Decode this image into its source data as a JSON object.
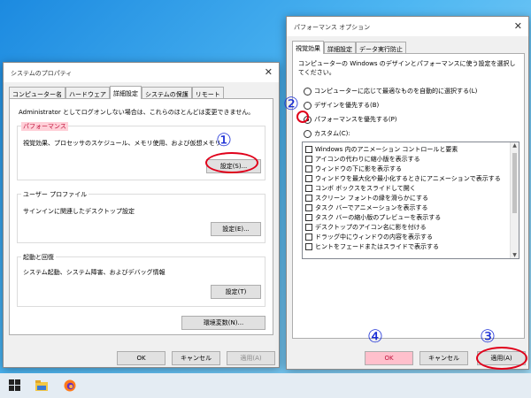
{
  "sysprops": {
    "title": "システムのプロパティ",
    "tabs": [
      "コンピューター名",
      "ハードウェア",
      "詳細設定",
      "システムの保護",
      "リモート"
    ],
    "admin_note": "Administrator としてログオンしない場合は、これらのほとんどは変更できません。",
    "perf_group": "パフォーマンス",
    "perf_desc": "視覚効果、プロセッサのスケジュール、メモリ使用、および仮想メモリ",
    "perf_button": "設定(S)...",
    "profile_group": "ユーザー プロファイル",
    "profile_desc": "サインインに関連したデスクトップ設定",
    "profile_button": "設定(E)...",
    "startup_group": "起動と回復",
    "startup_desc": "システム起動、システム障害、およびデバッグ情報",
    "startup_button": "設定(T)",
    "env_button": "環境変数(N)...",
    "ok": "OK",
    "cancel": "キャンセル",
    "apply": "適用(A)"
  },
  "perfopts": {
    "title": "パフォーマンス オプション",
    "tabs": [
      "視覚効果",
      "詳細設定",
      "データ実行防止"
    ],
    "desc": "コンピューターの Windows のデザインとパフォーマンスに使う設定を選択してください。",
    "radios": [
      {
        "label": "コンピューターに応じて最適なものを自動的に選択する(L)",
        "checked": false
      },
      {
        "label": "デザインを優先する(B)",
        "checked": false
      },
      {
        "label": "パフォーマンスを優先する(P)",
        "checked": true
      },
      {
        "label": "カスタム(C):",
        "checked": false
      }
    ],
    "effects": [
      "Windows 内のアニメーション コントロールと要素",
      "アイコンの代わりに縮小版を表示する",
      "ウィンドウの下に影を表示する",
      "ウィンドウを最大化や最小化するときにアニメーションで表示する",
      "コンボ ボックスをスライドして開く",
      "スクリーン フォントの縁を滑らかにする",
      "タスク バーでアニメーションを表示する",
      "タスク バーの縮小版のプレビューを表示する",
      "デスクトップのアイコン名に影を付ける",
      "ドラッグ中にウィンドウの内容を表示する",
      "ヒントをフェードまたはスライドで表示する"
    ],
    "ok": "OK",
    "cancel": "キャンセル",
    "apply": "適用(A)"
  },
  "annotations": [
    "①",
    "②",
    "③",
    "④"
  ],
  "colors": {
    "annotation": "#1b2fd6",
    "highlight_ring": "#e0001a",
    "highlight_fill": "#ffc0cc"
  },
  "taskbar": {
    "icons": [
      "windows-start-icon",
      "file-explorer-icon",
      "firefox-icon"
    ]
  }
}
